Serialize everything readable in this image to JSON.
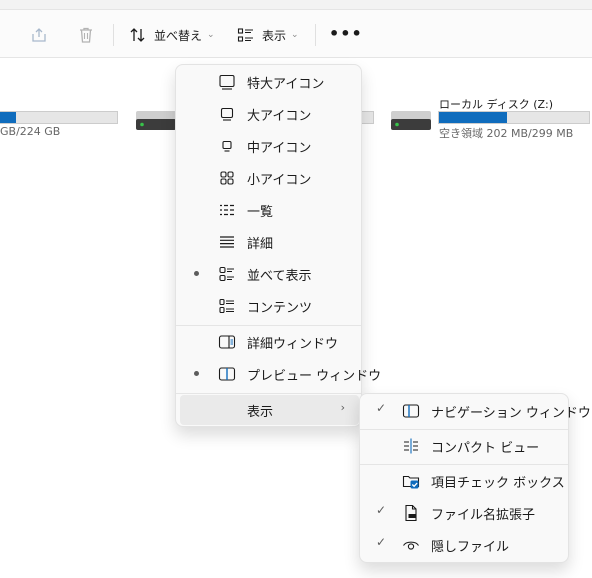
{
  "toolbar": {
    "share_icon": "share-icon",
    "delete_icon": "trash-icon",
    "sort_label": "並べ替え",
    "view_label": "表示",
    "more_label": "•••"
  },
  "drives": {
    "left": {
      "size_text": "GB/224 GB",
      "usage_fraction": 0.14
    },
    "middle": {
      "usage_fraction": 0.0
    },
    "right": {
      "name": "ローカル ディスク (Z:)",
      "size_text": "空き領域 202 MB/299 MB",
      "usage_fraction": 0.45
    }
  },
  "view_menu": {
    "items": [
      {
        "label": "特大アイコン",
        "icon": "extra-large-icons-icon",
        "selected": false
      },
      {
        "label": "大アイコン",
        "icon": "large-icons-icon",
        "selected": false
      },
      {
        "label": "中アイコン",
        "icon": "medium-icons-icon",
        "selected": false
      },
      {
        "label": "小アイコン",
        "icon": "small-icons-icon",
        "selected": false
      },
      {
        "label": "一覧",
        "icon": "list-icon",
        "selected": false
      },
      {
        "label": "詳細",
        "icon": "details-icon",
        "selected": false
      },
      {
        "label": "並べて表示",
        "icon": "tiles-icon",
        "selected": true
      },
      {
        "label": "コンテンツ",
        "icon": "content-icon",
        "selected": false
      },
      {
        "label": "詳細ウィンドウ",
        "icon": "details-pane-icon",
        "selected": false
      },
      {
        "label": "プレビュー ウィンドウ",
        "icon": "preview-pane-icon",
        "selected": true
      },
      {
        "label": "表示",
        "icon": "",
        "has_submenu": true
      }
    ]
  },
  "show_submenu": {
    "items": [
      {
        "label": "ナビゲーション ウィンドウ",
        "icon": "navigation-pane-icon",
        "checked": true
      },
      {
        "label": "コンパクト ビュー",
        "icon": "compact-view-icon",
        "checked": false
      },
      {
        "label": "項目チェック ボックス",
        "icon": "item-checkbox-icon",
        "checked": false
      },
      {
        "label": "ファイル名拡張子",
        "icon": "file-extension-icon",
        "checked": true
      },
      {
        "label": "隠しファイル",
        "icon": "hidden-files-icon",
        "checked": true
      }
    ]
  },
  "colors": {
    "accent": "#0f6cbd",
    "menu_bg": "#f9f9f9",
    "hover": "#eaeaea"
  }
}
